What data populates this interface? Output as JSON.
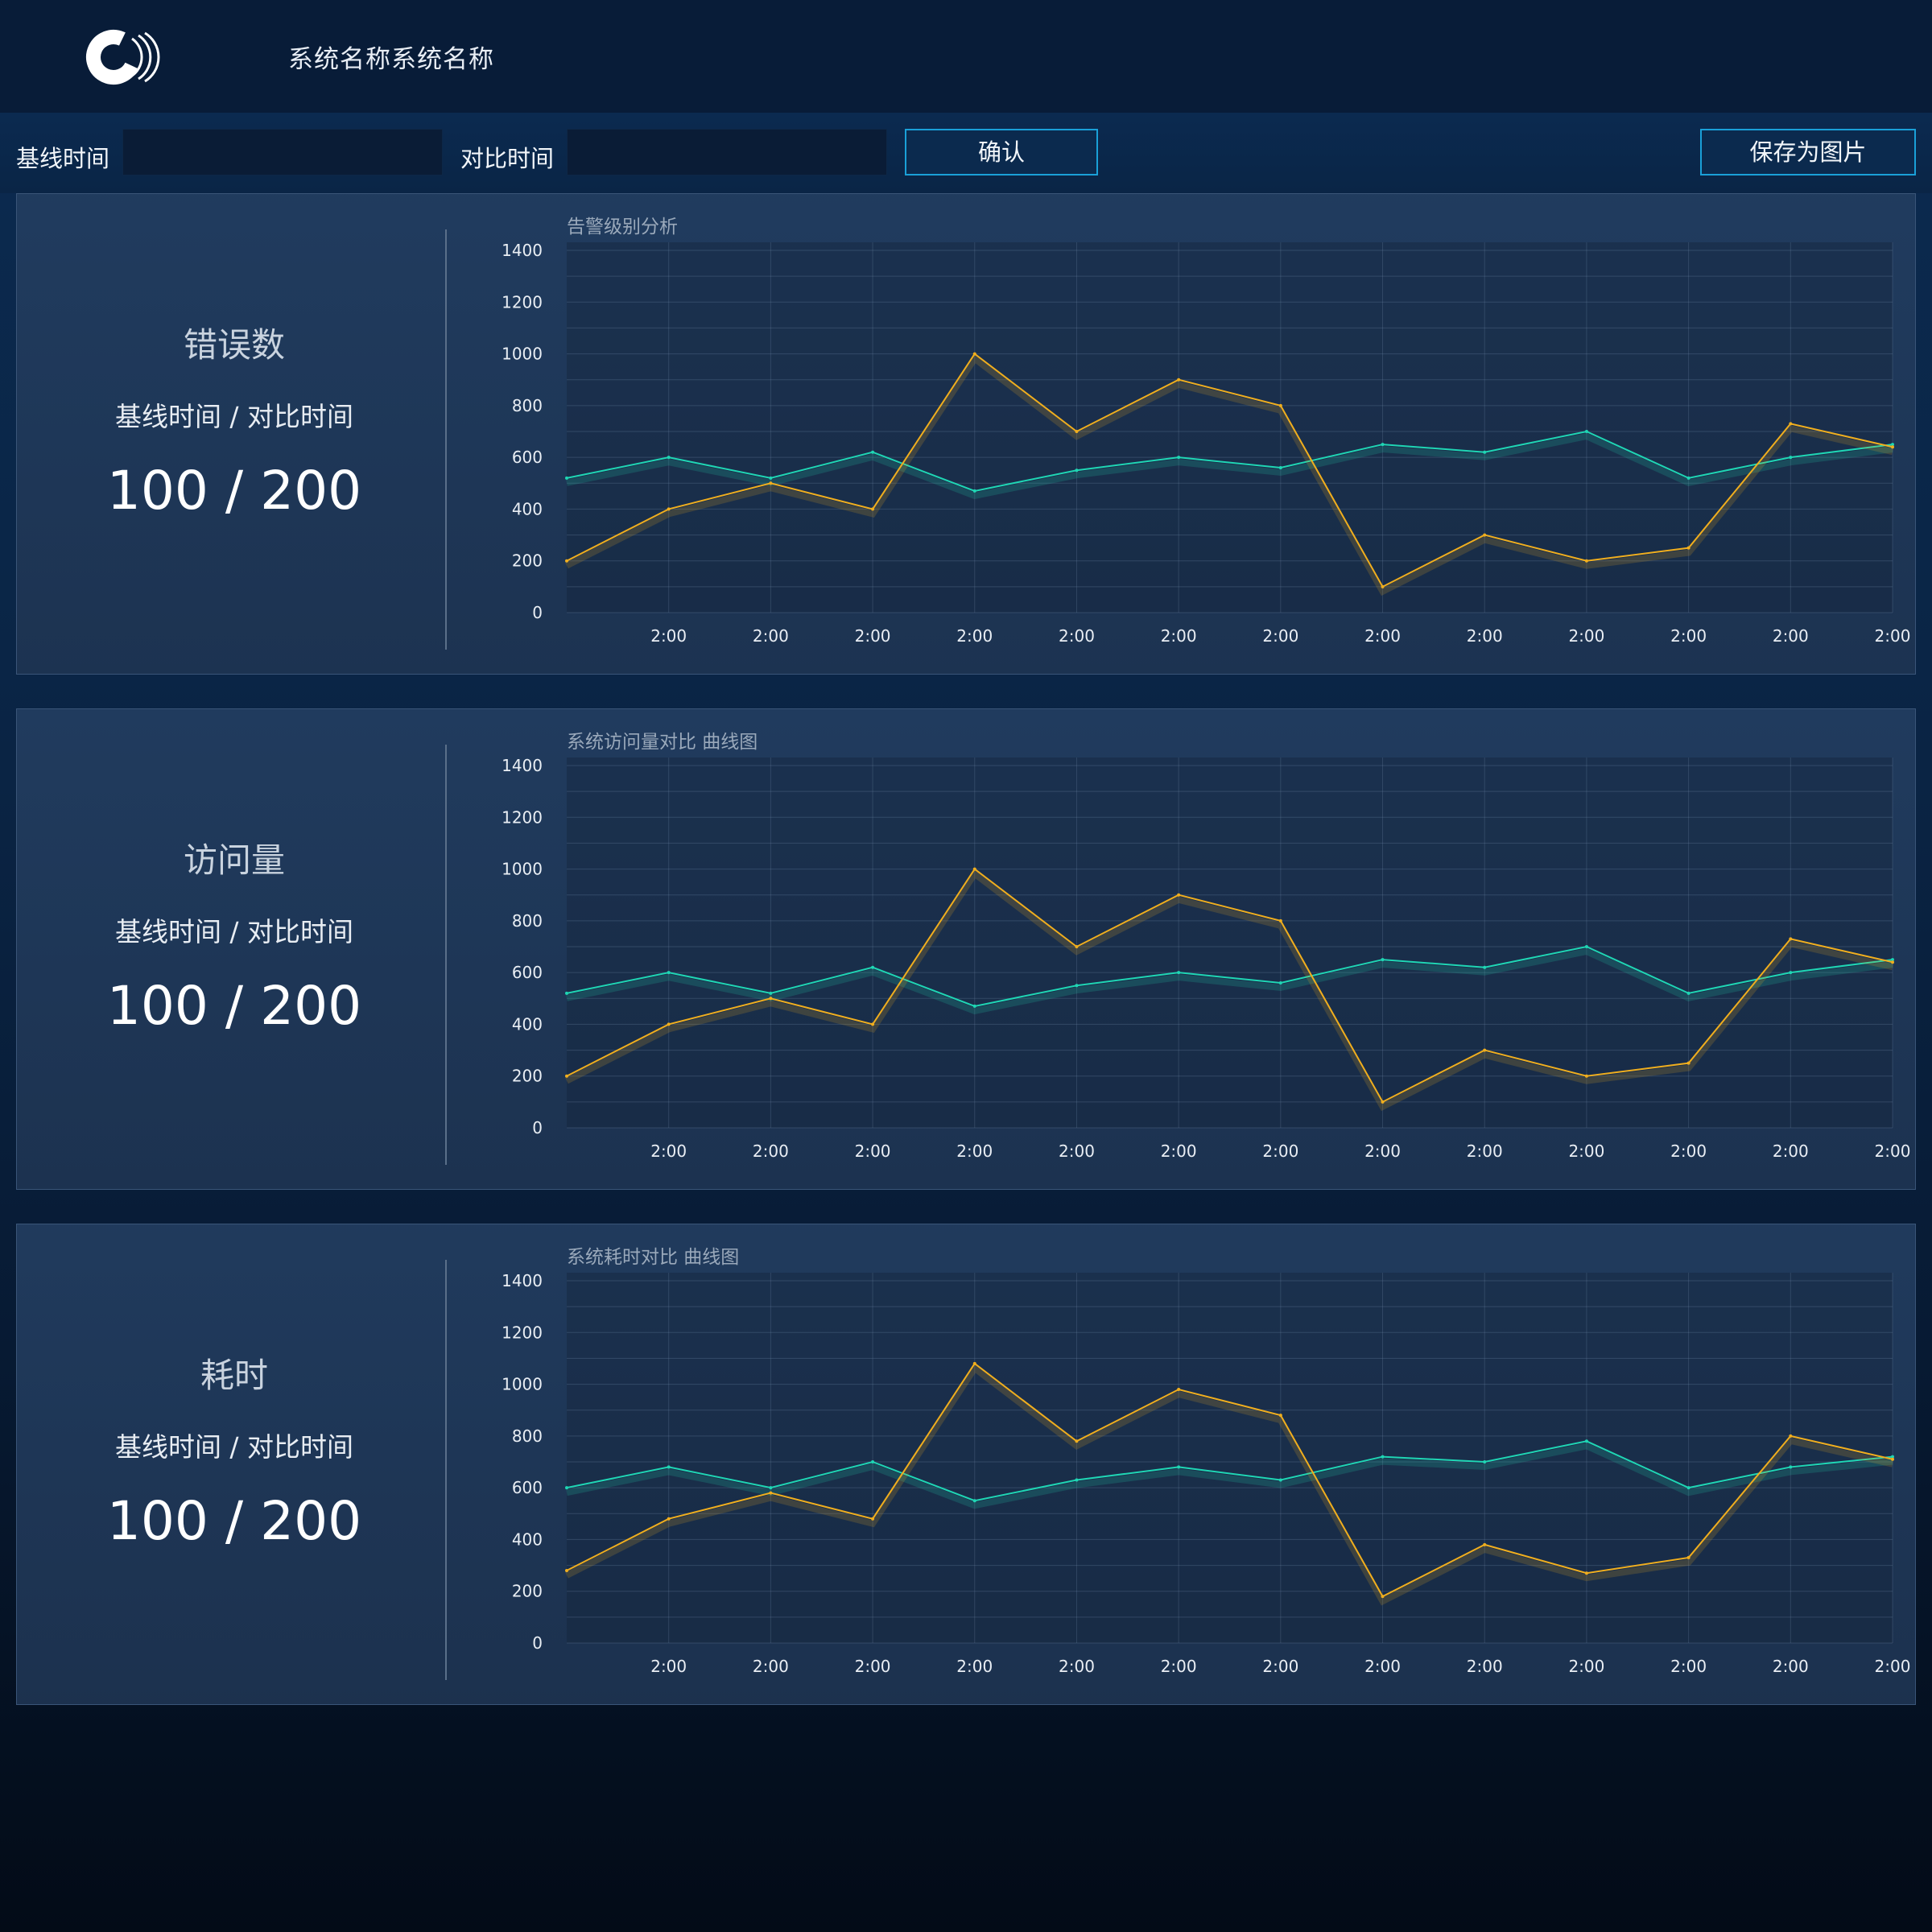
{
  "header": {
    "system_name": "系统名称系统名称"
  },
  "toolbar": {
    "baseline_label": "基线时间",
    "baseline_value": "",
    "compare_label": "对比时间",
    "compare_value": "",
    "confirm_label": "确认",
    "save_label": "保存为图片"
  },
  "colors": {
    "baseline_series": "#1fd6b4",
    "compare_series": "#f0ae1e",
    "button_border": "#1aa0d8"
  },
  "panels": [
    {
      "metric_name": "错误数",
      "metric_sub": "基线时间 / 对比时间",
      "metric_value": "100 / 200"
    },
    {
      "metric_name": "访问量",
      "metric_sub": "基线时间 / 对比时间",
      "metric_value": "100 / 200"
    },
    {
      "metric_name": "耗时",
      "metric_sub": "基线时间 / 对比时间",
      "metric_value": "100 / 200"
    }
  ],
  "chart_data": [
    {
      "type": "line",
      "title": "告警级别分析",
      "xlabel": "",
      "ylabel": "",
      "ylim": [
        0,
        1400
      ],
      "yticks": [
        "0",
        "200",
        "400",
        "600",
        "800",
        "1000",
        "1200",
        "1400"
      ],
      "x": [
        "",
        "2:00",
        "2:00",
        "2:00",
        "2:00",
        "2:00",
        "2:00",
        "2:00",
        "2:00",
        "2:00",
        "2:00",
        "2:00",
        "2:00",
        "2:00"
      ],
      "grid": true,
      "series": [
        {
          "values": [
            520,
            600,
            520,
            620,
            470,
            550,
            600,
            560,
            650,
            620,
            700,
            520,
            600,
            650
          ]
        },
        {
          "values": [
            200,
            400,
            500,
            400,
            1000,
            700,
            900,
            800,
            100,
            300,
            200,
            250,
            730,
            640
          ]
        }
      ]
    },
    {
      "type": "line",
      "title": "系统访问量对比 曲线图",
      "xlabel": "",
      "ylabel": "",
      "ylim": [
        0,
        1400
      ],
      "yticks": [
        "0",
        "200",
        "400",
        "600",
        "800",
        "1000",
        "1200",
        "1400"
      ],
      "x": [
        "",
        "2:00",
        "2:00",
        "2:00",
        "2:00",
        "2:00",
        "2:00",
        "2:00",
        "2:00",
        "2:00",
        "2:00",
        "2:00",
        "2:00",
        "2:00"
      ],
      "grid": true,
      "series": [
        {
          "values": [
            520,
            600,
            520,
            620,
            470,
            550,
            600,
            560,
            650,
            620,
            700,
            520,
            600,
            650
          ]
        },
        {
          "values": [
            200,
            400,
            500,
            400,
            1000,
            700,
            900,
            800,
            100,
            300,
            200,
            250,
            730,
            640
          ]
        }
      ]
    },
    {
      "type": "line",
      "title": "系统耗时对比 曲线图",
      "xlabel": "",
      "ylabel": "",
      "ylim": [
        0,
        1400
      ],
      "yticks": [
        "0",
        "200",
        "400",
        "600",
        "800",
        "1000",
        "1200",
        "1400"
      ],
      "x": [
        "",
        "2:00",
        "2:00",
        "2:00",
        "2:00",
        "2:00",
        "2:00",
        "2:00",
        "2:00",
        "2:00",
        "2:00",
        "2:00",
        "2:00",
        "2:00"
      ],
      "grid": true,
      "series": [
        {
          "values": [
            600,
            680,
            600,
            700,
            550,
            630,
            680,
            630,
            720,
            700,
            780,
            600,
            680,
            720
          ]
        },
        {
          "values": [
            280,
            480,
            580,
            480,
            1080,
            780,
            980,
            880,
            180,
            380,
            270,
            330,
            800,
            710
          ]
        }
      ]
    }
  ]
}
